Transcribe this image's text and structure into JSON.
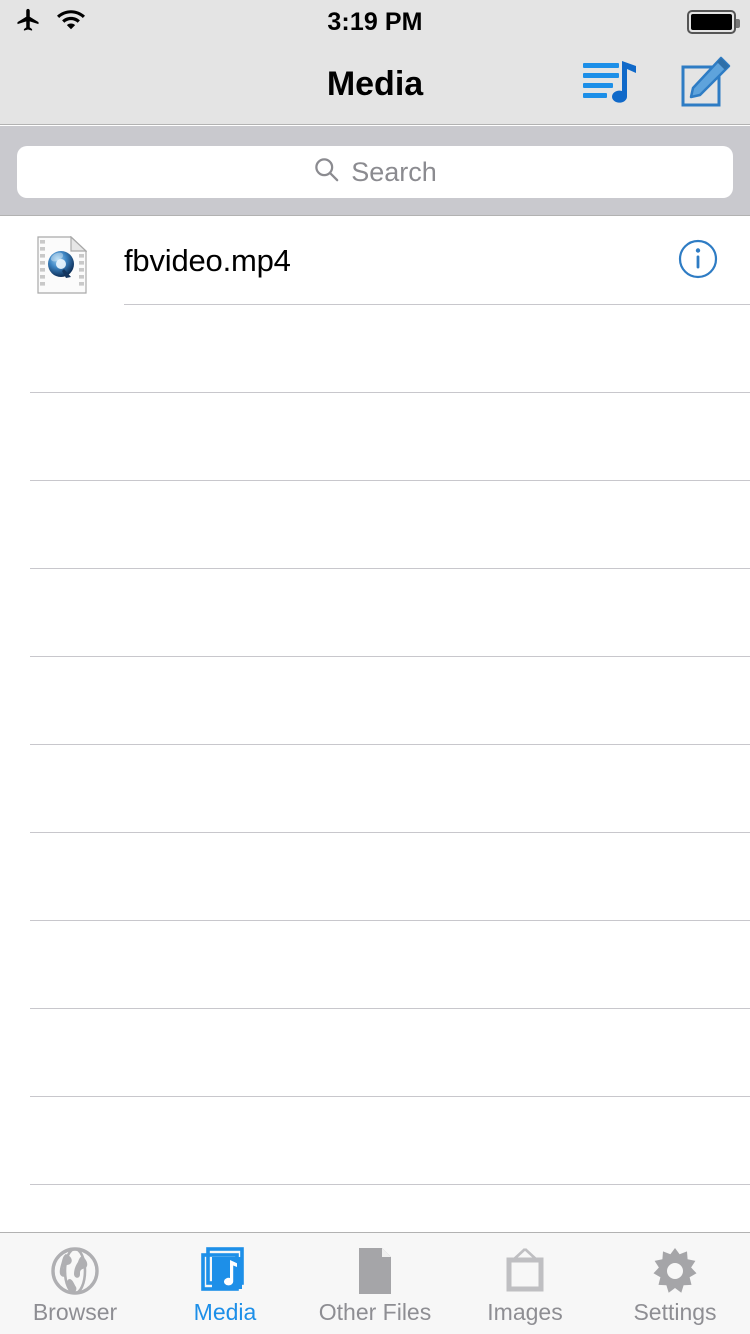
{
  "status_bar": {
    "airplane_icon": "airplane-mode-icon",
    "wifi_icon": "wifi-icon",
    "time": "3:19 PM",
    "battery_icon": "battery-full-icon"
  },
  "nav_bar": {
    "title": "Media",
    "actions": [
      {
        "name": "playlist-button",
        "icon": "playlist-music-icon"
      },
      {
        "name": "compose-button",
        "icon": "compose-pencil-icon"
      }
    ]
  },
  "search": {
    "placeholder": "Search",
    "value": "",
    "icon": "search-icon"
  },
  "list": {
    "items": [
      {
        "name": "fbvideo.mp4",
        "icon": "quicktime-video-file-icon",
        "accessory": "info-circle-icon"
      }
    ],
    "empty_row_count": 11
  },
  "tab_bar": {
    "active_index": 1,
    "tabs": [
      {
        "label": "Browser",
        "icon": "globe-icon"
      },
      {
        "label": "Media",
        "icon": "media-stack-music-icon"
      },
      {
        "label": "Other Files",
        "icon": "document-page-icon"
      },
      {
        "label": "Images",
        "icon": "picture-frame-icon"
      },
      {
        "label": "Settings",
        "icon": "gear-icon"
      }
    ]
  },
  "colors": {
    "accent": "#1D8FE8",
    "nav_bg": "#E4E4E4",
    "search_bg": "#C9C9CE",
    "tab_inactive": "#8E8E93",
    "separator": "#C8C7CC"
  }
}
